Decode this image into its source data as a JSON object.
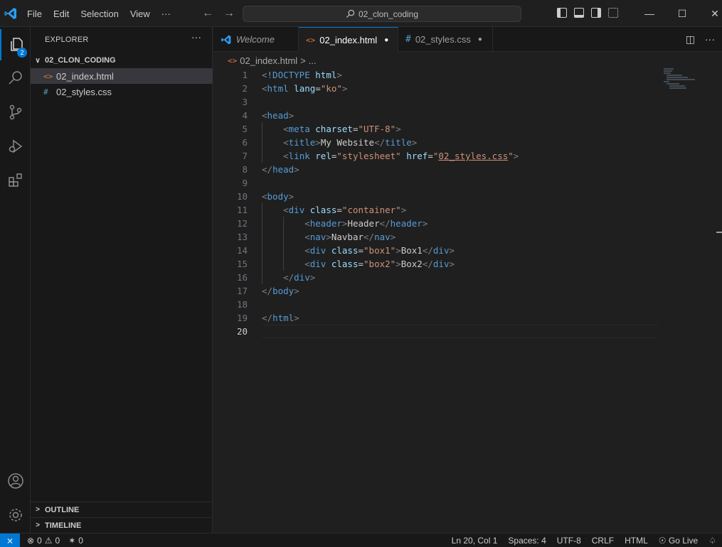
{
  "titlebar": {
    "menu": [
      "File",
      "Edit",
      "Selection",
      "View",
      "···"
    ],
    "search_text": "02_clon_coding",
    "back": "←",
    "forward": "→"
  },
  "activity": {
    "explorer_badge": "2"
  },
  "sidebar": {
    "title": "EXPLORER",
    "more": "···",
    "folder_name": "02_CLON_CODING",
    "files": [
      {
        "name": "02_index.html",
        "icon": "<>",
        "kind": "html"
      },
      {
        "name": "02_styles.css",
        "icon": "#",
        "kind": "css"
      }
    ],
    "outline_label": "OUTLINE",
    "timeline_label": "TIMELINE"
  },
  "tabs": [
    {
      "label": "Welcome"
    },
    {
      "label": "02_index.html",
      "icon": "<>"
    },
    {
      "label": "02_styles.css",
      "icon": "#"
    }
  ],
  "breadcrumb": {
    "file": "02_index.html",
    "sep": ">",
    "rest": "..."
  },
  "editor": {
    "line_numbers": [
      "1",
      "2",
      "3",
      "4",
      "5",
      "6",
      "7",
      "8",
      "9",
      "10",
      "11",
      "12",
      "13",
      "14",
      "15",
      "16",
      "17",
      "18",
      "19",
      "20"
    ],
    "current_line": "20"
  },
  "statusbar": {
    "errors": "0",
    "warnings": "0",
    "ports": "0",
    "position": "Ln 20, Col 1",
    "spaces": "Spaces: 4",
    "encoding": "UTF-8",
    "eol": "CRLF",
    "language": "HTML",
    "golive": "Go Live"
  },
  "colors": {
    "accent": "#0078d4",
    "tag": "#569cd6",
    "attr": "#9cdcfe",
    "string": "#ce9178"
  }
}
